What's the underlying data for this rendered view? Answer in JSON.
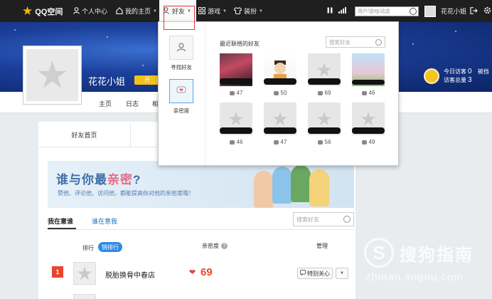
{
  "topbar": {
    "logo": "QQ空间",
    "nav": [
      {
        "label": "个人中心"
      },
      {
        "label": "我的主页"
      },
      {
        "label": "好友"
      },
      {
        "label": "游戏"
      },
      {
        "label": "装扮"
      }
    ],
    "search_placeholder": "用户/游戏/动态",
    "username": "花花小姐"
  },
  "profile": {
    "nickname": "花花小姐",
    "vip_label": "开",
    "visitors_today_label": "今日访客",
    "visitors_today": "0",
    "visitors_total_label": "访客总量",
    "visitors_total": "3",
    "extra_label": "被挡"
  },
  "main_nav": [
    "主页",
    "日志",
    "相"
  ],
  "subtab": {
    "active": "好友首页"
  },
  "ad": {
    "title_pre": "谁与你最",
    "title_em": "亲密",
    "title_post": "?",
    "subtitle": "赞他、评论他、访问他，都能提高你对他的亲密度哦！"
  },
  "friends_section": {
    "tab_active": "我在意谁",
    "tab_other": "谁在意我",
    "search_placeholder": "搜索好友"
  },
  "table": {
    "col_rank": "排行",
    "sort_pill": "销排行",
    "col_intimacy": "亲密度",
    "help": "?",
    "col_manage": "管理",
    "rows": [
      {
        "rank": "1",
        "name": "脱胎换骨中春店",
        "score": "69",
        "action": "特别关心"
      }
    ]
  },
  "dropdown": {
    "side": [
      {
        "label": "寻找好友"
      },
      {
        "label": "亲密度"
      }
    ],
    "title": "最近联络的好友",
    "search_placeholder": "搜索好友",
    "friends": [
      {
        "count": "47"
      },
      {
        "count": "50"
      },
      {
        "count": "69"
      },
      {
        "count": "46"
      },
      {
        "count": "46"
      },
      {
        "count": "47"
      },
      {
        "count": "56"
      },
      {
        "count": "49"
      }
    ]
  },
  "watermark": {
    "icon_letter": "S",
    "text": "搜狗指南",
    "url": "zhinan.sogou.com"
  },
  "colors": {
    "accent_blue": "#2e8ae6",
    "intimacy_red": "#e8452c",
    "topbar_bg": "#1f1f1f",
    "highlight_box": "#e03a3a"
  }
}
